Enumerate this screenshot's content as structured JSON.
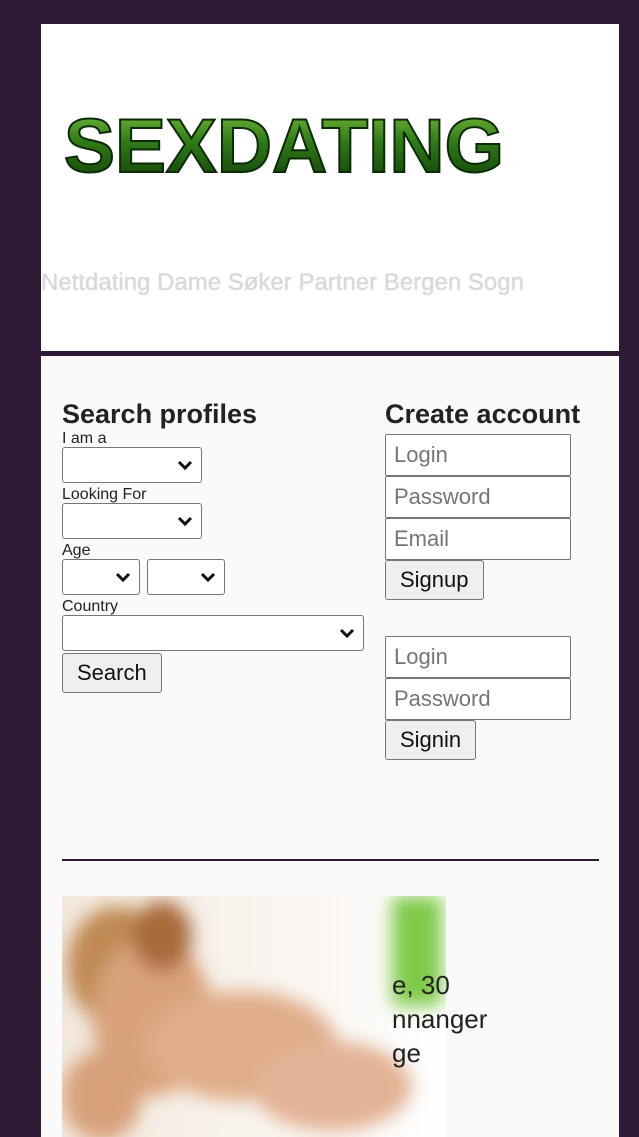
{
  "header": {
    "logo_text": "SEXDATING",
    "tagline": "Nettdating Dame Søker Partner Bergen Sogn"
  },
  "search": {
    "title": "Search profiles",
    "i_am_label": "I am a",
    "looking_for_label": "Looking For",
    "age_label": "Age",
    "country_label": "Country",
    "i_am_value": "",
    "looking_for_value": "",
    "age_from_value": "",
    "age_to_value": "",
    "country_value": "",
    "search_button": "Search"
  },
  "signup": {
    "title": "Create account",
    "login_placeholder": "Login",
    "password_placeholder": "Password",
    "email_placeholder": "Email",
    "signup_button": "Signup"
  },
  "signin": {
    "login_placeholder": "Login",
    "password_placeholder": "Password",
    "signin_button": "Signin"
  },
  "profile": {
    "line1": "e, 30",
    "line2": "nnanger",
    "line3": "ge"
  }
}
